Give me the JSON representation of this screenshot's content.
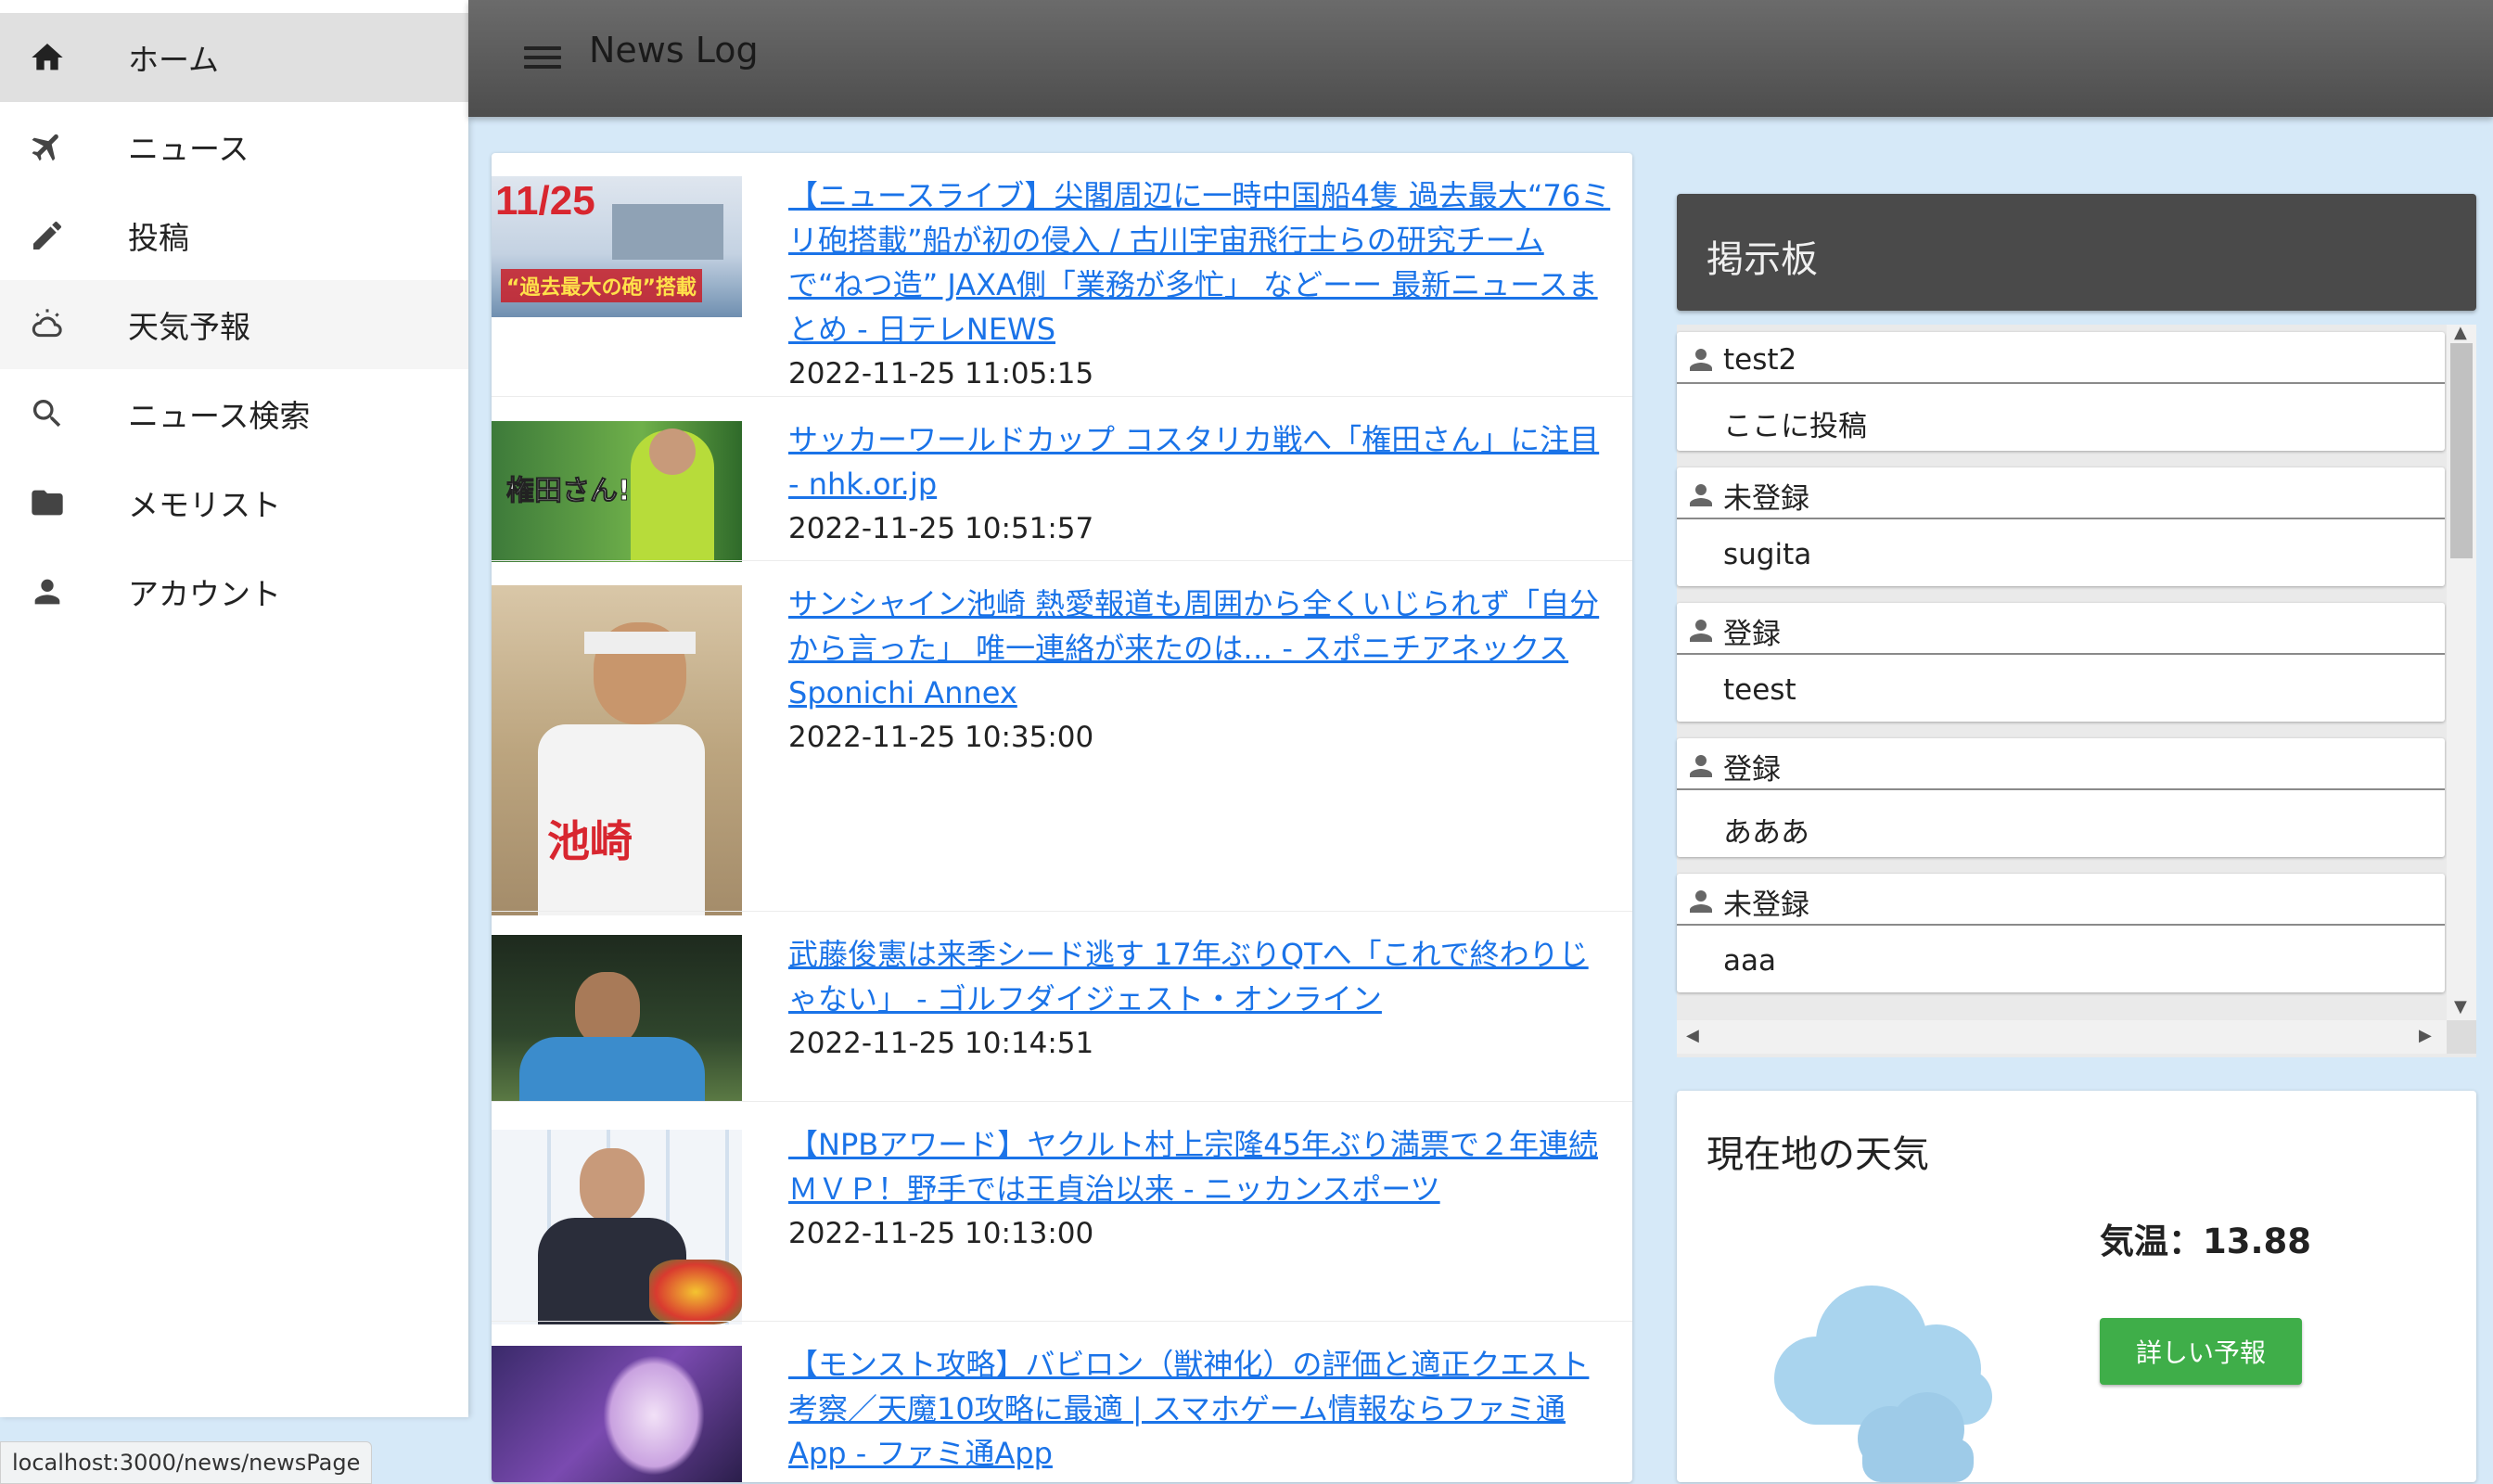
{
  "header": {
    "title": "News Log"
  },
  "sidebar": {
    "items": [
      {
        "label": "ホーム",
        "icon": "home-icon"
      },
      {
        "label": "ニュース",
        "icon": "airplane-icon"
      },
      {
        "label": "投稿",
        "icon": "pencil-icon"
      },
      {
        "label": "天気予報",
        "icon": "weather-icon"
      },
      {
        "label": "ニュース検索",
        "icon": "search-icon"
      },
      {
        "label": "メモリスト",
        "icon": "folder-icon"
      },
      {
        "label": "アカウント",
        "icon": "person-icon"
      }
    ]
  },
  "news": [
    {
      "title": "【ニュースライブ】尖閣周辺に一時中国船4隻 過去最大“76ミリ砲搭載”船が初の侵入 / 古川宇宙飛行士らの研究チームで“ねつ造” JAXA側「業務が多忙」 などーー 最新ニュースまとめ - 日テレNEWS",
      "time": "2022-11-25 11:05:15",
      "thumb_text": "11/25",
      "thumb_caption": "“過去最大の砲”搭載"
    },
    {
      "title": "サッカーワールドカップ コスタリカ戦へ「権田さん」に注目 - nhk.or.jp",
      "time": "2022-11-25 10:51:57",
      "thumb_text": "権田さん!"
    },
    {
      "title": "サンシャイン池崎 熱愛報道も周囲から全くいじられず「自分から言った」 唯一連絡が来たのは… - スポニチアネックス Sponichi Annex",
      "time": "2022-11-25 10:35:00",
      "thumb_text": "池崎"
    },
    {
      "title": "武藤俊憲は来季シード逃す 17年ぶりQTへ「これで終わりじゃない」 - ゴルフダイジェスト・オンライン",
      "time": "2022-11-25 10:14:51"
    },
    {
      "title": "【NPBアワード】ヤクルト村上宗隆45年ぶり満票で２年連続ＭＶＰ！野手では王貞治以来 - ニッカンスポーツ",
      "time": "2022-11-25 10:13:00"
    },
    {
      "title": "【モンスト攻略】バビロン（獣神化）の評価と適正クエスト考察／天魔10攻略に最適 | スマホゲーム情報ならファミ通App - ファミ通App",
      "time": ""
    }
  ],
  "board": {
    "title": "掲示板",
    "posts": [
      {
        "user": "test2",
        "body": "ここに投稿"
      },
      {
        "user": "未登録",
        "body": "sugita"
      },
      {
        "user": "登録",
        "body": "teest"
      },
      {
        "user": "登録",
        "body": "あああ"
      },
      {
        "user": "未登録",
        "body": "aaa"
      }
    ]
  },
  "weather": {
    "title": "現在地の天気",
    "temperature": "気温：13.88",
    "button": "詳しい予報"
  },
  "status_url": "localhost:3000/news/newsPage"
}
